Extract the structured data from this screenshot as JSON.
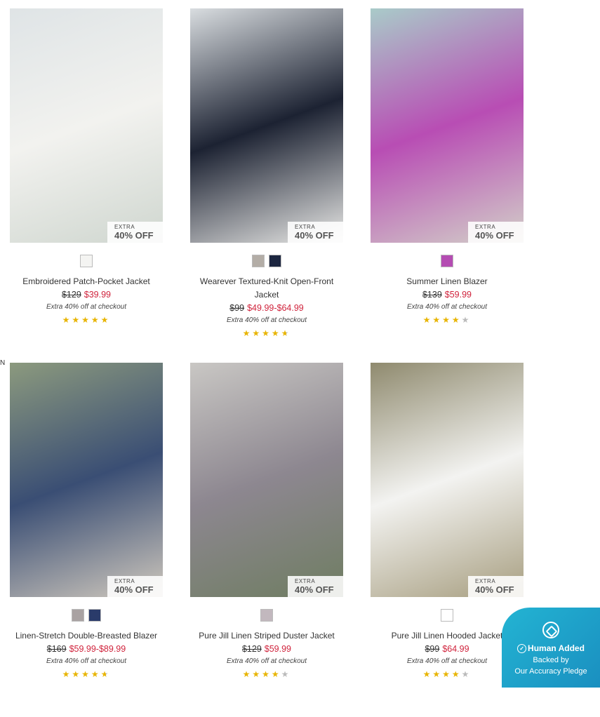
{
  "badge": {
    "extra": "EXTRA",
    "pct": "40% OFF"
  },
  "products": [
    {
      "name": "Embroidered Patch-Pocket Jacket",
      "was": "$129",
      "now": "$39.99",
      "promo": "Extra 40% off at checkout",
      "rating": 5,
      "half": false,
      "swatches": [
        "#f4f4f2"
      ],
      "bg": [
        "#dfe4e6",
        "#f2f2ef",
        "#cfd6cf"
      ]
    },
    {
      "name": "Wearever Textured-Knit Open-Front Jacket",
      "was": "$99",
      "now": "$49.99-$64.99",
      "promo": "Extra 40% off at checkout",
      "rating": 4.5,
      "half": true,
      "swatches": [
        "#b3ada6",
        "#1c2640"
      ],
      "bg": [
        "#d9dde0",
        "#1c2232",
        "#e9e9e7"
      ]
    },
    {
      "name": "Summer Linen Blazer",
      "was": "$139",
      "now": "$59.99",
      "promo": "Extra 40% off at checkout",
      "rating": 4,
      "half": false,
      "swatches": [
        "#b44cb2"
      ],
      "bg": [
        "#a9cbc9",
        "#b84db4",
        "#d2cfc8"
      ]
    },
    {
      "name": "Linen-Stretch Double-Breasted Blazer",
      "was": "$169",
      "now": "$59.99-$89.99",
      "promo": "Extra 40% off at checkout",
      "rating": 4.5,
      "half": true,
      "swatches": [
        "#a9a2a2",
        "#2a3b6a"
      ],
      "bg": [
        "#8c9a7e",
        "#3a4e74",
        "#cfc8bd"
      ]
    },
    {
      "name": "Pure Jill Linen Striped Duster Jacket",
      "was": "$129",
      "now": "$59.99",
      "promo": "Extra 40% off at checkout",
      "rating": 4,
      "half": false,
      "swatches": [
        "#c2b8be"
      ],
      "bg": [
        "#c9c7c4",
        "#8d8790",
        "#6f7d62"
      ]
    },
    {
      "name": "Pure Jill Linen Hooded Jacket",
      "was": "$99",
      "now": "$64.99",
      "promo": "Extra 40% off at checkout",
      "rating": 4,
      "half": false,
      "swatches": [
        "#ffffff"
      ],
      "bg": [
        "#8f8a6e",
        "#f3f3f1",
        "#a79e80"
      ]
    }
  ],
  "pledge": {
    "title": "Human Added",
    "sub1": "Backed by",
    "sub2": "Our Accuracy Pledge"
  },
  "edge_letter": "N"
}
